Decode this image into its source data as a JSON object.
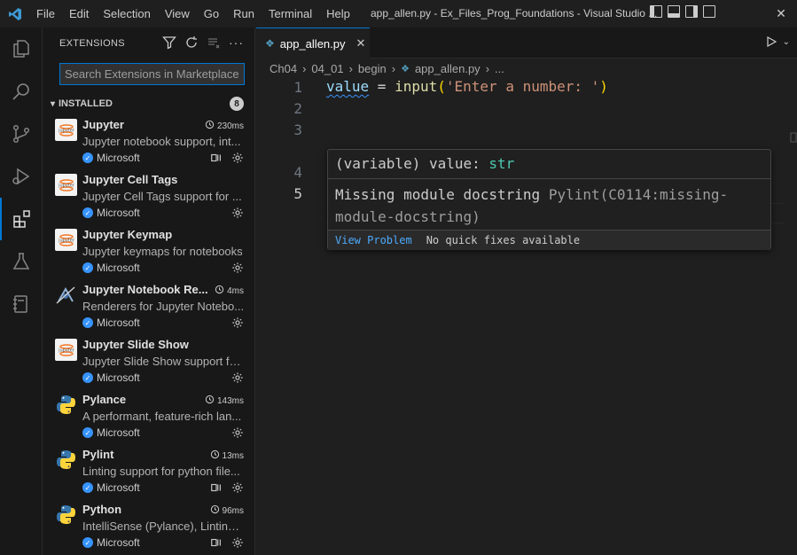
{
  "titlebar": {
    "menu": [
      "File",
      "Edit",
      "Selection",
      "View",
      "Go",
      "Run",
      "Terminal",
      "Help"
    ],
    "window_title": "app_allen.py - Ex_Files_Prog_Foundations - Visual Studio ..."
  },
  "sidebar": {
    "title": "EXTENSIONS",
    "search_placeholder": "Search Extensions in Marketplace",
    "section_label": "INSTALLED",
    "section_count": "8",
    "extensions": [
      {
        "name": "Jupyter",
        "time": "230ms",
        "desc": "Jupyter notebook support, int...",
        "publisher": "Microsoft",
        "logo": "jupyter-logo"
      },
      {
        "name": "Jupyter Cell Tags",
        "time": "",
        "desc": "Jupyter Cell Tags support for ...",
        "publisher": "Microsoft",
        "logo": "jupyter-logo"
      },
      {
        "name": "Jupyter Keymap",
        "time": "",
        "desc": "Jupyter keymaps for notebooks",
        "publisher": "Microsoft",
        "logo": "jupyter-logo"
      },
      {
        "name": "Jupyter Notebook Re...",
        "time": "4ms",
        "desc": "Renderers for Jupyter Notebo...",
        "publisher": "Microsoft",
        "logo": "renderer-logo"
      },
      {
        "name": "Jupyter Slide Show",
        "time": "",
        "desc": "Jupyter Slide Show support fo...",
        "publisher": "Microsoft",
        "logo": "jupyter-logo"
      },
      {
        "name": "Pylance",
        "time": "143ms",
        "desc": "A performant, feature-rich lan...",
        "publisher": "Microsoft",
        "logo": "python-logo"
      },
      {
        "name": "Pylint",
        "time": "13ms",
        "desc": "Linting support for python file...",
        "publisher": "Microsoft",
        "logo": "python-logo"
      },
      {
        "name": "Python",
        "time": "96ms",
        "desc": "IntelliSense (Pylance), Linting, ...",
        "publisher": "Microsoft",
        "logo": "python-logo"
      }
    ]
  },
  "editor": {
    "tab_label": "app_allen.py",
    "breadcrumb": [
      "Ch04",
      "04_01",
      "begin",
      "app_allen.py",
      "..."
    ],
    "line_numbers": [
      "1",
      "2",
      "3",
      "4",
      "5"
    ],
    "line1": {
      "var": "value",
      "eq": " = ",
      "fn": "input",
      "open": "(",
      "str": "'Enter a number: '",
      "close": ")"
    },
    "hover": {
      "signature_prefix": "(variable) value: ",
      "signature_type": "str",
      "message": "Missing module docstring ",
      "source": "Pylint(C0114:missing-module-docstring)",
      "view_problem": "View Problem",
      "no_quick_fixes": "No quick fixes available"
    }
  },
  "colors": {
    "accent": "#0078d4",
    "link": "#4daafc",
    "verified": "#3794ff"
  }
}
